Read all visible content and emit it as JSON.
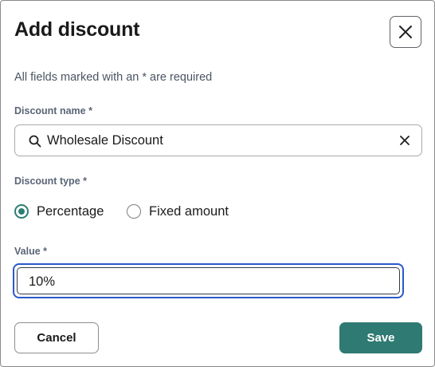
{
  "dialog": {
    "title": "Add discount",
    "required_note": "All fields marked with an * are required"
  },
  "discount_name": {
    "label": "Discount name *",
    "value": "Wholesale Discount",
    "search_icon": "search-icon",
    "clear_icon": "close-icon"
  },
  "discount_type": {
    "label": "Discount type *",
    "options": [
      {
        "label": "Percentage",
        "selected": true
      },
      {
        "label": "Fixed amount",
        "selected": false
      }
    ]
  },
  "value": {
    "label": "Value *",
    "value": "10%"
  },
  "actions": {
    "cancel_label": "Cancel",
    "save_label": "Save"
  },
  "colors": {
    "primary": "#2f7a72",
    "radio_checked": "#2e7d72",
    "focus_ring": "#2a58c9",
    "label_text": "#5a6577"
  }
}
